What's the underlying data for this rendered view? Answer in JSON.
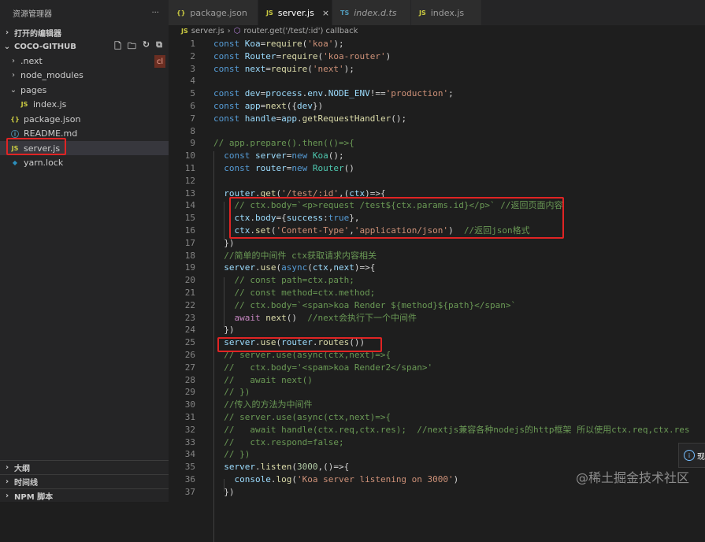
{
  "explorer": {
    "title": "资源管理器",
    "more": "···",
    "open_editors": "打开的编辑器",
    "project": "COCO-GITHUB",
    "badge": "cl",
    "tree": [
      {
        "name": ".next",
        "kind": "folder",
        "indent": 1,
        "expanded": false
      },
      {
        "name": "node_modules",
        "kind": "folder",
        "indent": 1,
        "expanded": false
      },
      {
        "name": "pages",
        "kind": "folder",
        "indent": 1,
        "expanded": true
      },
      {
        "name": "index.js",
        "kind": "js",
        "indent": 2
      },
      {
        "name": "package.json",
        "kind": "json",
        "indent": 1
      },
      {
        "name": "README.md",
        "kind": "info",
        "indent": 1
      },
      {
        "name": "server.js",
        "kind": "js",
        "indent": 1,
        "selected": true
      },
      {
        "name": "yarn.lock",
        "kind": "yarn",
        "indent": 1
      }
    ],
    "bottom_sections": [
      "大纲",
      "时间线",
      "NPM 脚本"
    ]
  },
  "tabs": [
    {
      "label": "package.json",
      "icon": "{}",
      "kind": "json",
      "active": false
    },
    {
      "label": "server.js",
      "icon": "JS",
      "kind": "js",
      "active": true
    },
    {
      "label": "index.d.ts",
      "icon": "TS",
      "kind": "ts",
      "active": false
    },
    {
      "label": "index.js",
      "icon": "JS",
      "kind": "js",
      "active": false
    }
  ],
  "breadcrumb": {
    "file": "server.js",
    "separator": "›",
    "symbol": "router.get('/test/:id') callback"
  },
  "code_lines": [
    [
      [
        "kw",
        "const "
      ],
      [
        "var",
        "Koa"
      ],
      [
        "",
        "="
      ],
      [
        "fn",
        "require"
      ],
      [
        "",
        "("
      ],
      [
        "str",
        "'koa'"
      ],
      [
        "",
        ");"
      ]
    ],
    [
      [
        "kw",
        "const "
      ],
      [
        "var",
        "Router"
      ],
      [
        "",
        "="
      ],
      [
        "fn",
        "require"
      ],
      [
        "",
        "("
      ],
      [
        "str",
        "'koa-router'"
      ],
      [
        "",
        ")"
      ]
    ],
    [
      [
        "kw",
        "const "
      ],
      [
        "var",
        "next"
      ],
      [
        "",
        ""
      ],
      [
        "",
        ""
      ],
      [
        "",
        "="
      ],
      [
        "fn",
        "require"
      ],
      [
        "",
        "("
      ],
      [
        "str",
        "'next'"
      ],
      [
        "",
        ");"
      ]
    ],
    [],
    [
      [
        "kw",
        "const "
      ],
      [
        "var",
        "dev"
      ],
      [
        "",
        "="
      ],
      [
        "var",
        "process"
      ],
      [
        "",
        "."
      ],
      [
        "var",
        "env"
      ],
      [
        "",
        "."
      ],
      [
        "var",
        "NODE_ENV"
      ],
      [
        "",
        "!=="
      ],
      [
        "str",
        "'production'"
      ],
      [
        "",
        ";"
      ]
    ],
    [
      [
        "kw",
        "const "
      ],
      [
        "var",
        "app"
      ],
      [
        "",
        "="
      ],
      [
        "fn",
        "next"
      ],
      [
        "",
        "({"
      ],
      [
        "var",
        "dev"
      ],
      [
        "",
        "})"
      ]
    ],
    [
      [
        "kw",
        "const "
      ],
      [
        "var",
        "handle"
      ],
      [
        "",
        "="
      ],
      [
        "var",
        "app"
      ],
      [
        "",
        "."
      ],
      [
        "fn",
        "getRequestHandler"
      ],
      [
        "",
        "();"
      ]
    ],
    [],
    [
      [
        "cm",
        "// app.prepare().then(()=>{"
      ]
    ],
    [
      [
        "",
        "  "
      ],
      [
        "kw",
        "const "
      ],
      [
        "var",
        "server"
      ],
      [
        "",
        "="
      ],
      [
        "kw",
        "new "
      ],
      [
        "cls",
        "Koa"
      ],
      [
        "",
        "();"
      ]
    ],
    [
      [
        "",
        "  "
      ],
      [
        "kw",
        "const "
      ],
      [
        "var",
        "router"
      ],
      [
        "",
        "="
      ],
      [
        "kw",
        "new "
      ],
      [
        "cls",
        "Router"
      ],
      [
        "",
        "()"
      ]
    ],
    [],
    [
      [
        "",
        "  "
      ],
      [
        "var",
        "router"
      ],
      [
        "",
        "."
      ],
      [
        "fn",
        "get"
      ],
      [
        "",
        "("
      ],
      [
        "str",
        "'/test/:id'"
      ],
      [
        "",
        ",("
      ],
      [
        "var",
        "ctx"
      ],
      [
        "",
        ")=>{"
      ]
    ],
    [
      [
        "",
        "    "
      ],
      [
        "cm",
        "// ctx.body=`<p>request /test${ctx.params.id}</p>` //返回页面内容"
      ]
    ],
    [
      [
        "",
        "    "
      ],
      [
        "var",
        "ctx"
      ],
      [
        "",
        "."
      ],
      [
        "var",
        "body"
      ],
      [
        "",
        "={"
      ],
      [
        "var",
        "success"
      ],
      [
        "",
        ":"
      ],
      [
        "kw",
        "true"
      ],
      [
        "",
        "},"
      ]
    ],
    [
      [
        "",
        "    "
      ],
      [
        "var",
        "ctx"
      ],
      [
        "",
        "."
      ],
      [
        "fn",
        "set"
      ],
      [
        "",
        "("
      ],
      [
        "str",
        "'Content-Type'"
      ],
      [
        "",
        ","
      ],
      [
        "str",
        "'application/json'"
      ],
      [
        "",
        ")  "
      ],
      [
        "cm",
        "//返回json格式"
      ]
    ],
    [
      [
        "",
        "  })"
      ]
    ],
    [
      [
        "",
        "  "
      ],
      [
        "cm",
        "//简单的中间件 ctx获取请求内容相关"
      ]
    ],
    [
      [
        "",
        "  "
      ],
      [
        "var",
        "server"
      ],
      [
        "",
        "."
      ],
      [
        "fn",
        "use"
      ],
      [
        "",
        "("
      ],
      [
        "kw",
        "async"
      ],
      [
        "",
        "("
      ],
      [
        "var",
        "ctx"
      ],
      [
        "",
        ","
      ],
      [
        "var",
        "next"
      ],
      [
        "",
        ")=>{"
      ]
    ],
    [
      [
        "",
        "    "
      ],
      [
        "cm",
        "// const path=ctx.path;"
      ]
    ],
    [
      [
        "",
        "    "
      ],
      [
        "cm",
        "// const method=ctx.method;"
      ]
    ],
    [
      [
        "",
        "    "
      ],
      [
        "cm",
        "// ctx.body=`<span>koa Render ${method}${path}</span>`"
      ]
    ],
    [
      [
        "",
        "    "
      ],
      [
        "ctl",
        "await "
      ],
      [
        "fn",
        "next"
      ],
      [
        "",
        "()  "
      ],
      [
        "cm",
        "//next会执行下一个中间件"
      ]
    ],
    [
      [
        "",
        "  })"
      ]
    ],
    [
      [
        "",
        "  "
      ],
      [
        "var",
        "server"
      ],
      [
        "",
        "."
      ],
      [
        "fn",
        "use"
      ],
      [
        "",
        "("
      ],
      [
        "var",
        "router"
      ],
      [
        "",
        "."
      ],
      [
        "fn",
        "routes"
      ],
      [
        "",
        "())"
      ]
    ],
    [
      [
        "",
        "  "
      ],
      [
        "cm",
        "// server.use(async(ctx,next)=>{"
      ]
    ],
    [
      [
        "",
        "  "
      ],
      [
        "cm",
        "//   ctx.body='<spam>koa Render2</span>'"
      ]
    ],
    [
      [
        "",
        "  "
      ],
      [
        "cm",
        "//   await next()"
      ]
    ],
    [
      [
        "",
        "  "
      ],
      [
        "cm",
        "// })"
      ]
    ],
    [
      [
        "",
        "  "
      ],
      [
        "cm",
        "//传入的方法为中间件"
      ]
    ],
    [
      [
        "",
        "  "
      ],
      [
        "cm",
        "// server.use(async(ctx,next)=>{"
      ]
    ],
    [
      [
        "",
        "  "
      ],
      [
        "cm",
        "//   await handle(ctx.req,ctx.res);  //nextjs兼容各种nodejs的http框架 所以使用ctx.req,ctx.res"
      ]
    ],
    [
      [
        "",
        "  "
      ],
      [
        "cm",
        "//   ctx.respond=false;"
      ]
    ],
    [
      [
        "",
        "  "
      ],
      [
        "cm",
        "// })"
      ]
    ],
    [
      [
        "",
        "  "
      ],
      [
        "var",
        "server"
      ],
      [
        "",
        "."
      ],
      [
        "fn",
        "listen"
      ],
      [
        "",
        "("
      ],
      [
        "num",
        "3000"
      ],
      [
        "",
        ",()=>{"
      ]
    ],
    [
      [
        "",
        "    "
      ],
      [
        "var",
        "console"
      ],
      [
        "",
        "."
      ],
      [
        "fn",
        "log"
      ],
      [
        "",
        "("
      ],
      [
        "str",
        "'Koa server listening on 3000'"
      ],
      [
        "",
        ")"
      ]
    ],
    [
      [
        "",
        "  })"
      ]
    ]
  ],
  "notification": {
    "text": "现"
  },
  "watermark": "@稀土掘金技术社区"
}
